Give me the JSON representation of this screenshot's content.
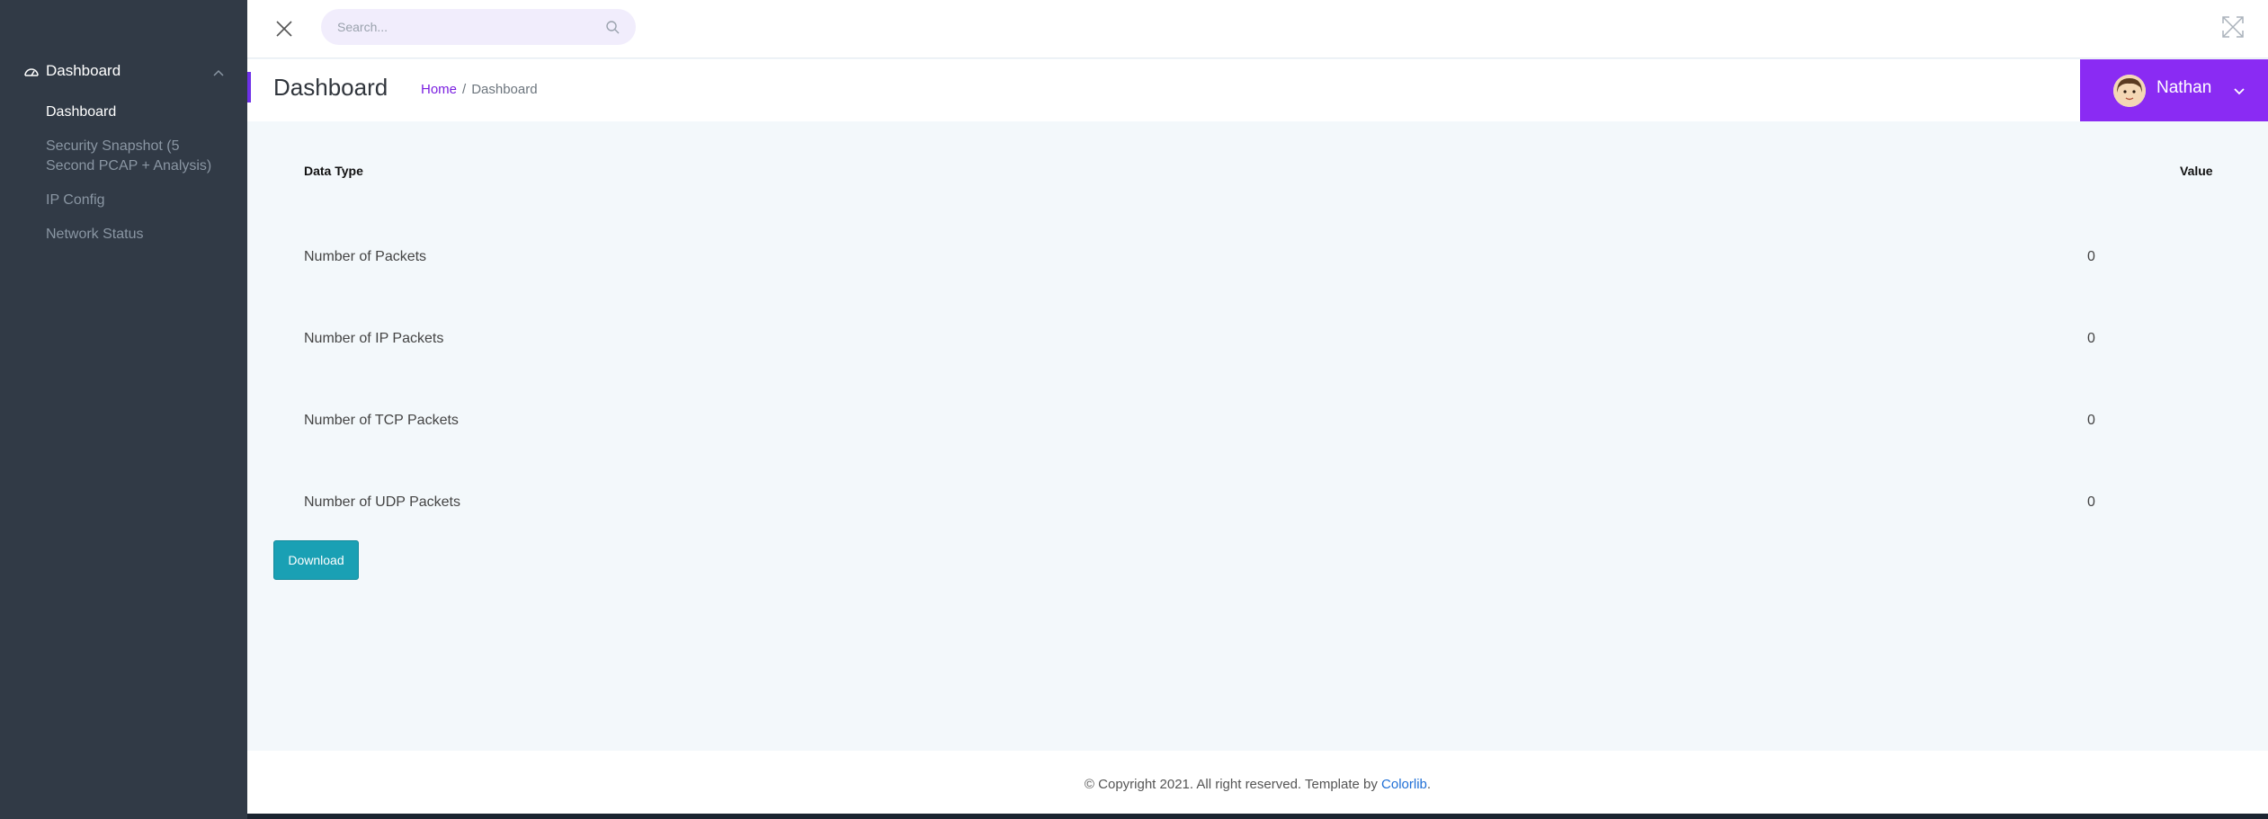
{
  "sidebar": {
    "group_label": "Dashboard",
    "items": [
      {
        "label": "Dashboard",
        "active": true
      },
      {
        "label_line1": "Security Snapshot (5",
        "label_line2": "Second PCAP + Analysis)"
      },
      {
        "label": "IP Config"
      },
      {
        "label": "Network Status"
      }
    ]
  },
  "topbar": {
    "search_placeholder": "Search..."
  },
  "header": {
    "title": "Dashboard",
    "breadcrumb": {
      "home": "Home",
      "separator": "/",
      "current": "Dashboard"
    },
    "user_name": "Nathan"
  },
  "table": {
    "headers": {
      "type": "Data Type",
      "value": "Value"
    },
    "rows": [
      {
        "label": "Number of Packets",
        "value": "0"
      },
      {
        "label": "Number of IP Packets",
        "value": "0"
      },
      {
        "label": "Number of TCP Packets",
        "value": "0"
      },
      {
        "label": "Number of UDP Packets",
        "value": "0"
      }
    ]
  },
  "download_label": "Download",
  "footer": {
    "text": "© Copyright 2021. All right reserved. Template by ",
    "link": "Colorlib",
    "suffix": "."
  },
  "colors": {
    "sidebar_bg": "#313a46",
    "accent_purple": "#8a2bf3",
    "download_teal": "#1aa0b4",
    "link_blue": "#1f6fd6"
  }
}
